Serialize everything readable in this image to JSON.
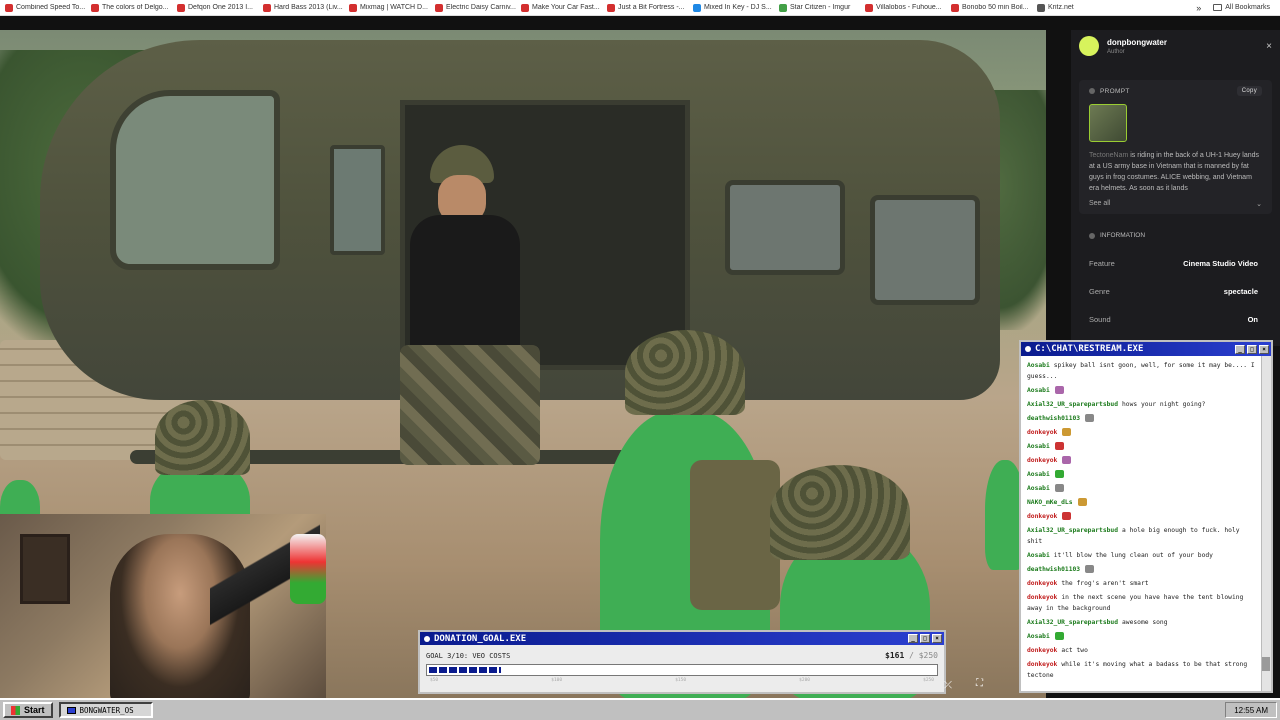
{
  "bookmarks": [
    {
      "label": "Combined Speed To...",
      "color": "#d32f2f"
    },
    {
      "label": "The colors of Delgo...",
      "color": "#d32f2f"
    },
    {
      "label": "Defqon One 2013 I...",
      "color": "#d32f2f"
    },
    {
      "label": "Hard Bass 2013 (Liv...",
      "color": "#d32f2f"
    },
    {
      "label": "Mixmag | WATCH D...",
      "color": "#d32f2f"
    },
    {
      "label": "Electric Daisy Carniv...",
      "color": "#d32f2f"
    },
    {
      "label": "Make Your Car Fast...",
      "color": "#d32f2f"
    },
    {
      "label": "Just a Bit Fortress -...",
      "color": "#d32f2f"
    },
    {
      "label": "Mixed In Key - DJ S...",
      "color": "#1e88e5"
    },
    {
      "label": "Star Citizen - Imgur",
      "color": "#43a047"
    },
    {
      "label": "Villalobos - Fuhoue...",
      "color": "#d32f2f"
    },
    {
      "label": "Bonobo 50 min Boil...",
      "color": "#d32f2f"
    },
    {
      "label": "Kritz.net",
      "color": "#555555"
    }
  ],
  "bookmarks_more": "»",
  "all_bookmarks": "All Bookmarks",
  "panel": {
    "author_name": "donpbongwater",
    "author_role": "Author",
    "close": "×",
    "prompt_heading": "PROMPT",
    "copy_label": "Copy",
    "prompt_tag": "TectoneNam",
    "prompt_text": " is riding in the back of a UH-1 Huey lands at a US army base in Vietnam that is manned by fat guys in frog costumes. ALICE webbing, and Vietnam era helmets. As soon as it lands",
    "see_all": "See all",
    "info_heading": "INFORMATION",
    "rows": [
      {
        "k": "Feature",
        "v": "Cinema Studio Video"
      },
      {
        "k": "Genre",
        "v": "spectacle"
      },
      {
        "k": "Sound",
        "v": "On"
      }
    ]
  },
  "chat": {
    "title": "C:\\CHAT\\RESTREAM.EXE",
    "messages": [
      {
        "user": "Aosabi",
        "text": "spikey ball isnt goon, well, for some it may be.... I guess..."
      },
      {
        "user": "Aosabi",
        "text": ""
      },
      {
        "user": "Axial32_UR_sparepartsbud",
        "text": "hows your night going?"
      },
      {
        "user": "deathwish01103",
        "text": ""
      },
      {
        "user": "donkeyok",
        "text": "",
        "red": true
      },
      {
        "user": "Aosabi",
        "text": ""
      },
      {
        "user": "donkeyok",
        "text": "",
        "red": true
      },
      {
        "user": "Aosabi",
        "text": ""
      },
      {
        "user": "Aosabi",
        "text": ""
      },
      {
        "user": "NAKO_mKe_dLs",
        "text": ""
      },
      {
        "user": "donkeyok",
        "text": "",
        "red": true
      },
      {
        "user": "Axial32_UR_sparepartsbud",
        "text": "a hole big enough to fuck. holy shit"
      },
      {
        "user": "Aosabi",
        "text": "it'll blow the lung clean out of your body"
      },
      {
        "user": "deathwish01103",
        "text": ""
      },
      {
        "user": "donkeyok",
        "text": "the frog's aren't smart",
        "red": true
      },
      {
        "user": "donkeyok",
        "text": "in the next scene you have have the tent blowing away in the background",
        "red": true
      },
      {
        "user": "Axial32_UR_sparepartsbud",
        "text": "awesome song"
      },
      {
        "user": "Aosabi",
        "text": ""
      },
      {
        "user": "donkeyok",
        "text": "act two",
        "red": true
      },
      {
        "user": "donkeyok",
        "text": "while it's moving what a badass to be that strong tectone",
        "red": true
      }
    ]
  },
  "donation": {
    "title": "DONATION_GOAL.EXE",
    "goal_label": "GOAL 3/10: VEO COSTS",
    "current": "$161",
    "separator": " / ",
    "target": "$250",
    "progress": 0.644,
    "ticks": [
      "$50",
      "$100",
      "$150",
      "$200",
      "$250"
    ]
  },
  "taskbar": {
    "start": "Start",
    "app": "BONGWATER_OS",
    "clock": "12:55 AM"
  }
}
